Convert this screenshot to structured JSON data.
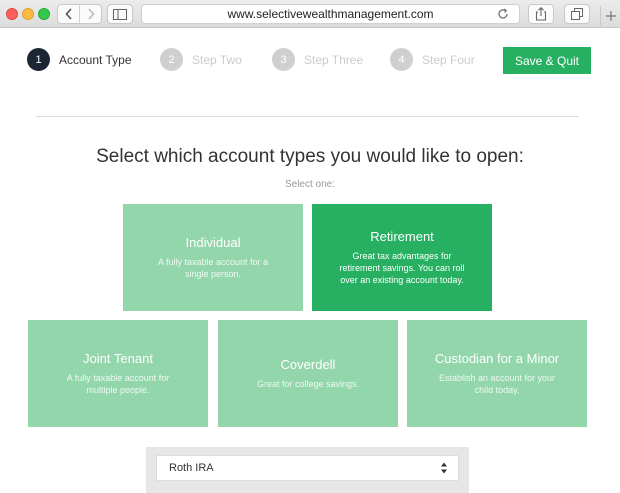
{
  "browser": {
    "url": "www.selectivewealthmanagement.com"
  },
  "steps": [
    {
      "num": "1",
      "label": "Account Type",
      "active": true
    },
    {
      "num": "2",
      "label": "Step Two",
      "active": false
    },
    {
      "num": "3",
      "label": "Step Three",
      "active": false
    },
    {
      "num": "4",
      "label": "Step Four",
      "active": false
    }
  ],
  "save_button": {
    "label": "Save & Quit"
  },
  "heading": "Select which account types you would like to open:",
  "subheading": "Select one:",
  "cards": [
    {
      "id": "individual",
      "title": "Individual",
      "desc": "A fully taxable account for a single person.",
      "selected": false
    },
    {
      "id": "retirement",
      "title": "Retirement",
      "desc": "Great tax advantages for retirement savings. You can roll over an existing account today.",
      "selected": true
    },
    {
      "id": "joint",
      "title": "Joint Tenant",
      "desc": "A fully taxable account for multiple people.",
      "selected": false
    },
    {
      "id": "coverdell",
      "title": "Coverdell",
      "desc": "Great for college savings.",
      "selected": false
    },
    {
      "id": "custodian",
      "title": "Custodian for a Minor",
      "desc": "Establish an account for your child today.",
      "selected": false
    }
  ],
  "account_select": {
    "value": "Roth IRA"
  },
  "colors": {
    "accent": "#27b062",
    "card_light": "#93d6ab",
    "step_active": "#1b2533",
    "step_inactive": "#cfcfcf"
  },
  "icons": [
    "back-arrow-icon",
    "forward-arrow-icon",
    "sidebar-icon",
    "reload-icon",
    "share-icon",
    "tabs-icon",
    "new-tab-icon",
    "select-arrows-icon"
  ]
}
